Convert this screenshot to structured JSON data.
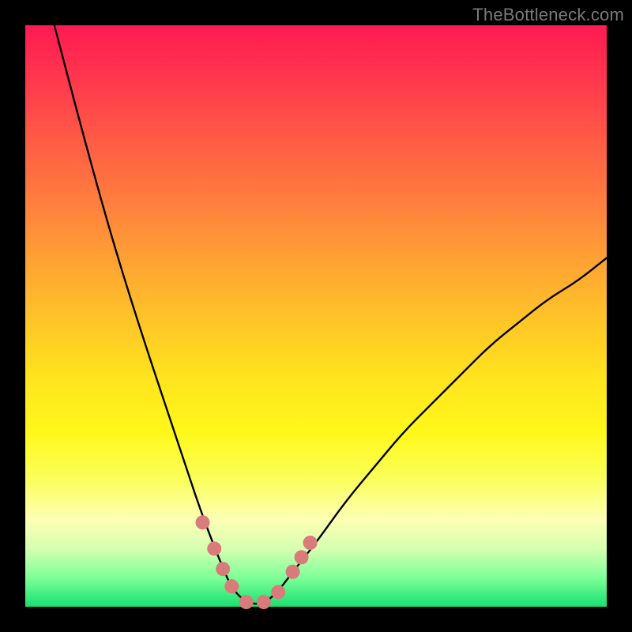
{
  "watermark": "TheBottleneck.com",
  "colors": {
    "background": "#000000",
    "curve": "#000000",
    "marker": "#d97b7a",
    "gradient_top": "#ff1a52",
    "gradient_bottom": "#18e070"
  },
  "chart_data": {
    "type": "line",
    "title": "",
    "xlabel": "",
    "ylabel": "",
    "xlim": [
      0,
      100
    ],
    "ylim": [
      0,
      100
    ],
    "note": "Axes are unlabeled; values are approximate percentages read from pixel positions. Curve is a V-shaped profile with a flat minimum near x≈36–43 and the right branch ending near y≈60 at x=100.",
    "series": [
      {
        "name": "curve",
        "x": [
          5,
          10,
          15,
          20,
          25,
          28,
          30,
          33,
          36,
          40,
          43,
          46,
          50,
          55,
          60,
          65,
          70,
          75,
          80,
          85,
          90,
          95,
          100
        ],
        "values": [
          100,
          81,
          63,
          47,
          32,
          23,
          17,
          9,
          2,
          0,
          2,
          6,
          11,
          18,
          24,
          30,
          35,
          40,
          45,
          49,
          53,
          56,
          60
        ]
      }
    ],
    "markers": {
      "name": "highlight-dots",
      "color": "#d97b7a",
      "x": [
        30.5,
        32.5,
        34.0,
        35.5,
        38.0,
        41.0,
        43.5,
        46.0,
        47.5,
        49.0
      ],
      "values": [
        14.5,
        10.0,
        6.5,
        3.5,
        0.8,
        0.8,
        2.5,
        6.0,
        8.5,
        11.0
      ]
    }
  }
}
